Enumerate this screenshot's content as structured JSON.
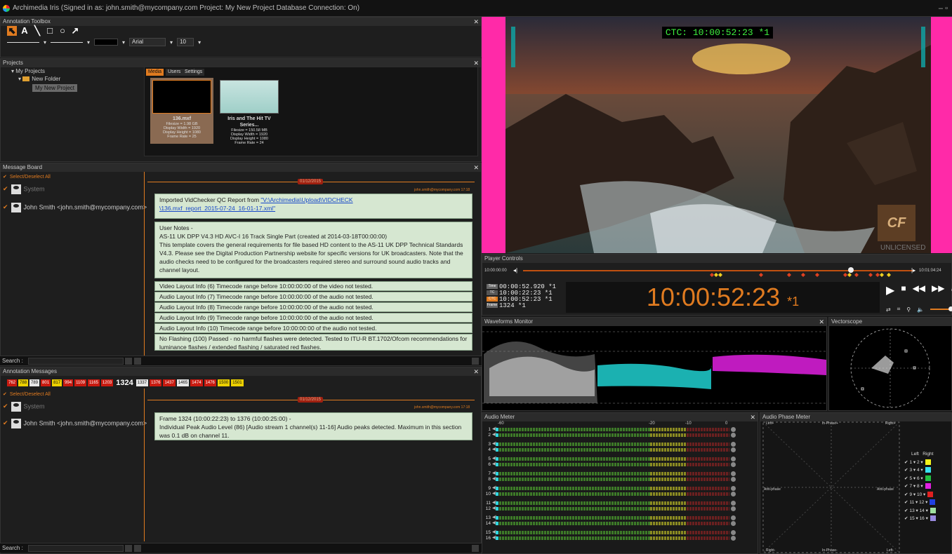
{
  "titlebar": {
    "text": "Archimedia Iris (Signed in as: john.smith@mycompany.com  Project: My New Project  Database Connection: On)",
    "controls": "–  ▫"
  },
  "annotation_toolbox": {
    "title": "Annotation Toolbox",
    "tools": [
      {
        "name": "select-tool",
        "glyph": "⬉"
      },
      {
        "name": "text-tool",
        "glyph": "A"
      },
      {
        "name": "line-tool",
        "glyph": "╲"
      },
      {
        "name": "rectangle-tool",
        "glyph": "□"
      },
      {
        "name": "ellipse-tool",
        "glyph": "○"
      },
      {
        "name": "arrow-tool",
        "glyph": "↗"
      }
    ],
    "font": "Arial",
    "font_size": "10"
  },
  "projects": {
    "title": "Projects",
    "tree": {
      "root": "My Projects",
      "folder": "New Folder",
      "project": "My New Project"
    },
    "tabs": [
      "Media",
      "Users",
      "Settings"
    ],
    "media": [
      {
        "name": "136.mxf",
        "details": [
          "Filesize = 1.98 GB",
          "Display Width = 1920",
          "Display Height = 1080",
          "Frame Rate = 25"
        ]
      },
      {
        "name": "Iris and The Hit TV Series...",
        "details": [
          "Filesize = 150.58 MB",
          "Display Width = 1920",
          "Display Height = 1080",
          "Frame Rate = 24"
        ]
      }
    ]
  },
  "message_board": {
    "title": "Message Board",
    "select_all": "Select/Deselect All",
    "users": [
      "System",
      "John Smith <john.smith@mycompany.com>"
    ],
    "date": "01/12/2015",
    "meta": "john.smith@mycompany.com  17:18",
    "msg_import_prefix": "Imported VidChecker QC Report from ",
    "msg_import_link1": "\"V:\\Archimedia\\Upload\\VIDCHECK",
    "msg_import_link2": "\\136.mxf_report_2015-07-24_16-01-17.xml\"",
    "notes": [
      "User Notes -",
      "AS-11 UK DPP V4.3 HD AVC-I 16 Track Single Part (created at 2014-03-18T00:00:00)",
      "This template covers the general requirements for file based HD content to the AS-11 UK DPP Technical Standards",
      "V4.3.  Please see the Digital Production Partnership website for specific versions for UK broadcasters. Note that the",
      "audio checks need to be configured for the broadcasters required stereo and surround sound audio tracks and",
      "channel layout."
    ],
    "items": [
      "Video Layout Info (6) Timecode range before 10:00:00:00 of the video not tested.",
      "Audio Layout Info (7) Timecode range before 10:00:00:00 of the audio not tested.",
      "Audio Layout Info (8) Timecode range before 10:00:00:00 of the audio not tested.",
      "Audio Layout Info (9) Timecode range before 10:00:00:00 of the audio not tested.",
      "Audio Layout Info (10) Timecode range before 10:00:00:00 of the audio not tested."
    ],
    "flash_1": "No Flashing (100) Passed - no harmful flashes were detected. Tested to ITU-R BT.1702/Ofcom recommendations for",
    "flash_2": "luminance flashes / extended flashing / saturated red flashes.",
    "search_label": "Search :"
  },
  "annotation_messages": {
    "title": "Annotation Messages",
    "frames": [
      {
        "v": "762",
        "c": "r"
      },
      {
        "v": "788",
        "c": "y"
      },
      {
        "v": "789",
        "c": "w"
      },
      {
        "v": "801",
        "c": "r"
      },
      {
        "v": "817",
        "c": "y"
      },
      {
        "v": "994",
        "c": "r"
      },
      {
        "v": "1109",
        "c": "r"
      },
      {
        "v": "1165",
        "c": "r"
      },
      {
        "v": "1203",
        "c": "r"
      },
      {
        "v": "1324",
        "c": "big"
      },
      {
        "v": "1337",
        "c": "w"
      },
      {
        "v": "1376",
        "c": "r"
      },
      {
        "v": "1437",
        "c": "r"
      },
      {
        "v": "1465",
        "c": "w"
      },
      {
        "v": "1474",
        "c": "r"
      },
      {
        "v": "1476",
        "c": "r"
      },
      {
        "v": "1500",
        "c": "y"
      },
      {
        "v": "1501",
        "c": "y"
      }
    ],
    "select_all": "Select/Deselect All",
    "users": [
      "System",
      "John Smith <john.smith@mycompany.com>"
    ],
    "date": "01/12/2015",
    "meta": "john.smith@mycompany.com  17:18",
    "message": [
      "Frame 1324 (10:00:22:23) to 1376 (10:00:25:00) -",
      "Individual Peak Audio Level (86) [Audio stream 1 channel(s) 11-16] Audio peaks detected. Maximum in this section",
      "was 0.1 dB on channel 11."
    ],
    "search_label": "Search :"
  },
  "video": {
    "ctc": "CTC: 10:00:52:23 *1",
    "watermark_logo": "CF",
    "watermark_text": "UNLICENSED"
  },
  "player_controls": {
    "title": "Player Controls",
    "start": "10:00:00:00",
    "end": "10:01:04:24",
    "position_fraction": 0.84,
    "rows": [
      {
        "tag": "Time",
        "value": "00:00:52.920 *1"
      },
      {
        "tag": "TC",
        "value": "10:00:22:23 *1"
      },
      {
        "tag": "CTC",
        "value": "10:00:52:23 *1"
      },
      {
        "tag": "Frame",
        "value": "1324 *1"
      }
    ],
    "big_timecode": "10:00:52:23",
    "big_suffix": "*1",
    "volume_fraction": 0.85
  },
  "waveform": {
    "title": "Waveforms Monitor"
  },
  "vectorscope": {
    "title": "Vectorscope"
  },
  "audio_meter": {
    "title": "Audio Meter",
    "scale": [
      "-60",
      "-20",
      "-10",
      "0"
    ],
    "channels": [
      "1",
      "2",
      "3",
      "4",
      "5",
      "6",
      "7",
      "8",
      "9",
      "10",
      "11",
      "12",
      "13",
      "14",
      "15",
      "16"
    ]
  },
  "audio_phase": {
    "title": "Audio Phase Meter",
    "labels": {
      "tl": "Left+",
      "tm": "In-Phase+",
      "tr": "Right+",
      "ml": "Anti-phase",
      "mr": "Anti-phase",
      "bl": "Right-",
      "bm": "In-Phase-",
      "br": "Left-"
    },
    "legend_header": [
      "Left",
      "Right"
    ],
    "pairs": [
      {
        "l": "1",
        "r": "2",
        "color": "#f2f21a"
      },
      {
        "l": "3",
        "r": "4",
        "color": "#3ae0f0"
      },
      {
        "l": "5",
        "r": "6",
        "color": "#22c040"
      },
      {
        "l": "7",
        "r": "8",
        "color": "#e020e0"
      },
      {
        "l": "9",
        "r": "10",
        "color": "#e02020"
      },
      {
        "l": "11",
        "r": "12",
        "color": "#2040e0"
      },
      {
        "l": "13",
        "r": "14",
        "color": "#a0e0a0"
      },
      {
        "l": "15",
        "r": "16",
        "color": "#9a8ae0"
      }
    ]
  },
  "colors": {
    "accent": "#e07b20",
    "bubble": "#d6e7d1",
    "magenta_bar": "#ff2aa8"
  }
}
